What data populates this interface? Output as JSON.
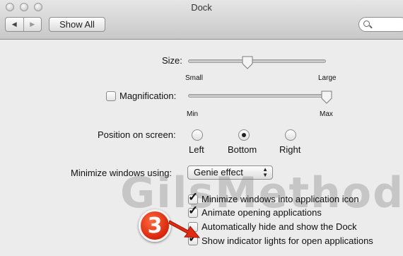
{
  "window": {
    "title": "Dock"
  },
  "toolbar": {
    "back_icon": "back-arrow-icon",
    "forward_icon": "forward-arrow-icon",
    "show_all_label": "Show All",
    "search_icon": "search-icon"
  },
  "size": {
    "label": "Size:",
    "min_label": "Small",
    "max_label": "Large",
    "value_fraction": 0.42
  },
  "magnification": {
    "label": "Magnification:",
    "checked": false,
    "min_label": "Min",
    "max_label": "Max",
    "value_fraction": 1.0
  },
  "position": {
    "label": "Position on screen:",
    "options": [
      {
        "label": "Left",
        "selected": false
      },
      {
        "label": "Bottom",
        "selected": true
      },
      {
        "label": "Right",
        "selected": false
      }
    ]
  },
  "minimize": {
    "label": "Minimize windows using:",
    "value": "Genie effect"
  },
  "checkboxes": [
    {
      "label": "Minimize windows into application icon",
      "checked": true
    },
    {
      "label": "Animate opening applications",
      "checked": true
    },
    {
      "label": "Automatically hide and show the Dock",
      "checked": false
    },
    {
      "label": "Show indicator lights for open applications",
      "checked": true
    }
  ],
  "watermark": "GilsMethod",
  "step_badge": "3",
  "colors": {
    "badge": "#e23a17",
    "arrow": "#e02a12"
  }
}
